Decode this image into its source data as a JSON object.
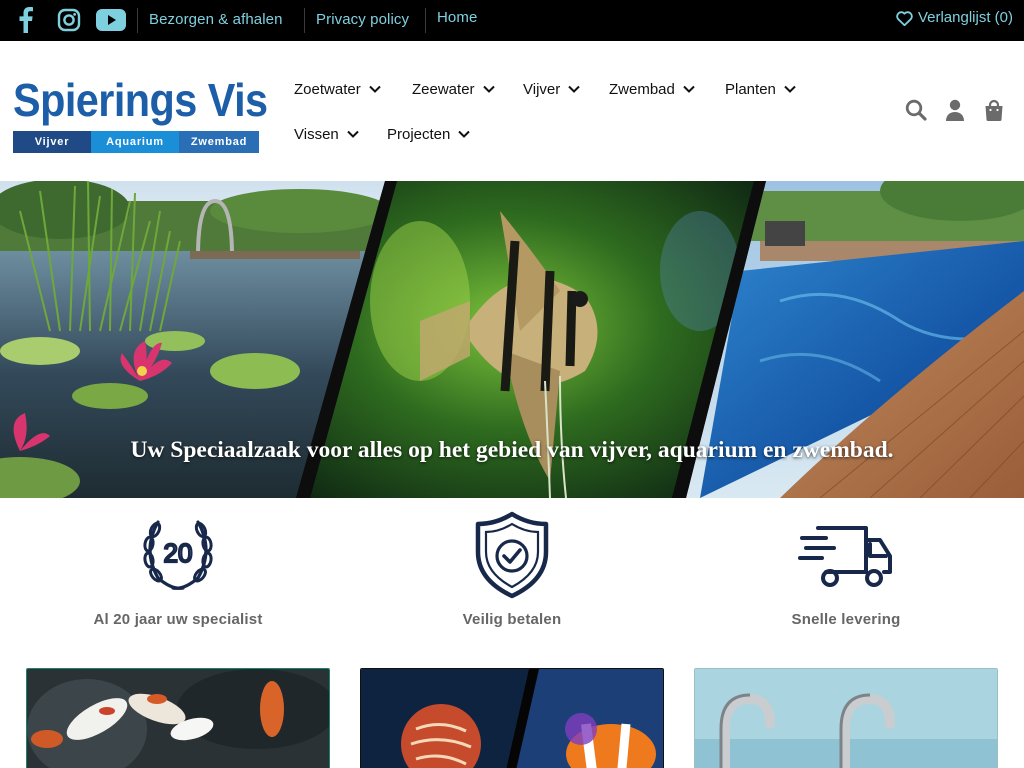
{
  "topbar": {
    "social": [
      {
        "name": "facebook-icon"
      },
      {
        "name": "instagram-icon"
      },
      {
        "name": "youtube-icon"
      }
    ],
    "links": [
      "Bezorgen & afhalen",
      "Privacy policy",
      "Home"
    ],
    "wishlist_label": "Verlanglijst (0)",
    "link_color": "#7fd0df"
  },
  "logo": {
    "word": "Spierings Vis",
    "band": [
      "Vijver",
      "Aquarium",
      "Zwembad"
    ]
  },
  "nav": {
    "items": [
      "Zoetwater",
      "Zeewater",
      "Vijver",
      "Zwembad",
      "Planten",
      "Vissen",
      "Projecten"
    ]
  },
  "header_icons": [
    "search-icon",
    "account-icon",
    "cart-icon"
  ],
  "hero": {
    "tagline": "Uw Speciaalzaak voor alles op het gebied van vijver, aquarium en zwembad."
  },
  "usps": [
    {
      "label": "Al 20 jaar uw specialist",
      "icon": "laurel-20-icon"
    },
    {
      "label": "Veilig betalen",
      "icon": "shield-check-icon"
    },
    {
      "label": "Snelle levering",
      "icon": "delivery-truck-icon"
    }
  ],
  "colors": {
    "brand_blue": "#1d5ea8",
    "icon_navy": "#18284a",
    "card_border": "#16846f"
  }
}
